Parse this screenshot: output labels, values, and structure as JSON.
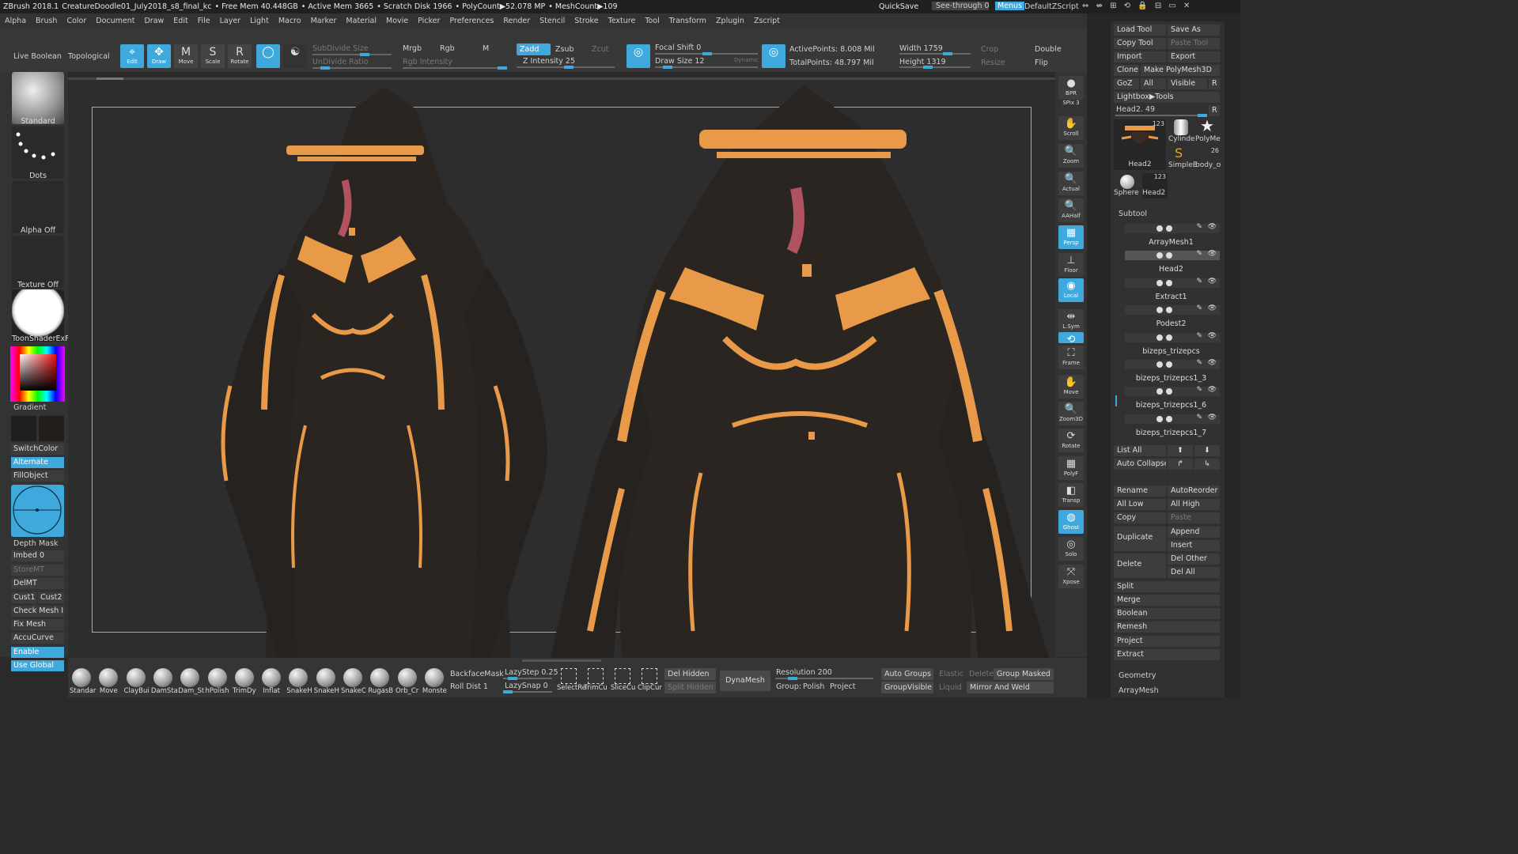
{
  "titlebar": {
    "app": "ZBrush 2018.1",
    "file": "CreatureDoodle01_July2018_s8_final_kc",
    "free_mem": "• Free Mem 40.448GB",
    "active_mem": "• Active Mem 3665",
    "scratch": "• Scratch Disk 1966",
    "polycount": "• PolyCount▶52.078 MP",
    "meshcount": "• MeshCount▶109",
    "quicksave": "QuickSave",
    "seethrough": "See-through  0",
    "menus": "Menus",
    "script": "DefaultZScript"
  },
  "menubar": [
    "Alpha",
    "Brush",
    "Color",
    "Document",
    "Draw",
    "Edit",
    "File",
    "Layer",
    "Light",
    "Macro",
    "Marker",
    "Material",
    "Movie",
    "Picker",
    "Preferences",
    "Render",
    "Stencil",
    "Stroke",
    "Texture",
    "Tool",
    "Transform",
    "Zplugin",
    "Zscript"
  ],
  "topshelf": {
    "live_boolean": "Live Boolean",
    "topological": "Topological",
    "tools": [
      "Edit",
      "Draw",
      "Move",
      "Scale",
      "Rotate"
    ],
    "subdivide_size": "SubDivide Size",
    "undivide_ratio": "UnDivide Ratio",
    "mrgb": "Mrgb",
    "rgb": "Rgb",
    "m": "M",
    "rgb_intensity": "Rgb Intensity",
    "zadd": "Zadd",
    "zsub": "Zsub",
    "zcut": "Zcut",
    "z_intensity": "Z Intensity 25",
    "focal_shift": "Focal Shift 0",
    "draw_size": "Draw Size 12",
    "dynamic": "Dynamic",
    "active_points": "ActivePoints: 8.008 Mil",
    "total_points": "TotalPoints: 48.797 Mil",
    "width": "Width 1759",
    "height": "Height 1319",
    "crop": "Crop",
    "resize": "Resize",
    "double": "Double",
    "flip": "Flip"
  },
  "leftshelf": {
    "brush": "Standard",
    "stroke": "Dots",
    "alpha": "Alpha Off",
    "texture": "Texture Off",
    "material": "ToonShaderExF",
    "gradient": "Gradient",
    "switchcolor": "SwitchColor",
    "alternate": "Alternate",
    "fillobject": "FillObject",
    "depth_mask": "Depth Mask",
    "imbed": "Imbed 0",
    "storemt": "StoreMT",
    "delmt": "DelMT",
    "cust1": "Cust1",
    "cust2": "Cust2",
    "check_mesh": "Check Mesh In",
    "fix_mesh": "Fix Mesh",
    "accucurve": "AccuCurve",
    "enable": "Enable",
    "use_global": "Use Global"
  },
  "rightshelf": [
    {
      "label": "BPR",
      "icon": "bpr-sphere-icon"
    },
    {
      "label": "SPix 3",
      "icon": ""
    },
    {
      "label": "Scroll",
      "icon": "hand-icon"
    },
    {
      "label": "Zoom",
      "icon": "zoom-icon"
    },
    {
      "label": "Actual",
      "icon": "zoom-icon"
    },
    {
      "label": "AAHalf",
      "icon": "zoom-icon"
    },
    {
      "label": "Persp",
      "icon": "grid-icon"
    },
    {
      "label": "Floor",
      "icon": "floor-icon"
    },
    {
      "label": "Local",
      "icon": "local-icon"
    },
    {
      "label": "L.Sym",
      "icon": "sym-icon"
    },
    {
      "label": "xyz",
      "icon": "xyz-icon"
    },
    {
      "label": "Frame",
      "icon": "frame-icon"
    },
    {
      "label": "Move",
      "icon": "hand-icon"
    },
    {
      "label": "Zoom3D",
      "icon": "zoom-icon"
    },
    {
      "label": "Rotate",
      "icon": "rotate-icon"
    },
    {
      "label": "PolyF",
      "icon": "polyframe-icon"
    },
    {
      "label": "Transp",
      "icon": "transp-icon"
    },
    {
      "label": "Ghost",
      "icon": "ghost-icon"
    },
    {
      "label": "Solo",
      "icon": "solo-icon"
    },
    {
      "label": "Xpose",
      "icon": "xpose-icon"
    }
  ],
  "tool_palette": {
    "load_tool": "Load Tool",
    "save_as": "Save As",
    "copy_tool": "Copy Tool",
    "paste_tool": "Paste Tool",
    "import": "Import",
    "export": "Export",
    "clone": "Clone",
    "make_polymesh": "Make PolyMesh3D",
    "goz": "GoZ",
    "all": "All",
    "visible": "Visible",
    "r": "R",
    "lightbox_tools": "Lightbox▶Tools",
    "current": "Head2. 49",
    "thumb_main": "Head2",
    "thumb_main_count": "123",
    "thumbs": [
      "Cylinde",
      "PolyMe",
      "SimpleE",
      "body_o",
      "Sphere",
      "Head2"
    ],
    "thumb_count_26": "26",
    "thumb_count_123": "123"
  },
  "subtool": {
    "title": "Subtool",
    "items": [
      "ArrayMesh1",
      "Head2",
      "Extract1",
      "Podest2",
      "bizeps_trizepcs",
      "bizeps_trizepcs1_3",
      "bizeps_trizepcs1_6",
      "bizeps_trizepcs1_7"
    ],
    "list_all": "List All",
    "auto_collapse": "Auto Collapse",
    "rename": "Rename",
    "autoreorder": "AutoReorder",
    "all_low": "All Low",
    "all_high": "All High",
    "copy": "Copy",
    "paste": "Paste",
    "duplicate": "Duplicate",
    "append": "Append",
    "insert": "Insert",
    "delete": "Delete",
    "del_other": "Del Other",
    "del_all": "Del All",
    "split": "Split",
    "merge": "Merge",
    "boolean": "Boolean",
    "remesh": "Remesh",
    "project": "Project",
    "extract": "Extract",
    "geometry": "Geometry",
    "arraymesh": "ArrayMesh"
  },
  "bottom": {
    "brushes": [
      "Standar",
      "Move",
      "ClayBui",
      "DamSta",
      "Dam_St",
      "hPolish",
      "TrimDy",
      "Inflat",
      "SnakeH",
      "SnakeH",
      "SnakeC",
      "RugasB",
      "Orb_Cr",
      "Monste"
    ],
    "backface_mask": "BackfaceMask",
    "roll_dist": "Roll Dist 1",
    "lazystep": "LazyStep 0.25",
    "lazysnap": "LazySnap 0",
    "selects": [
      "SelectRe",
      "TrimCu",
      "SliceCu",
      "ClipCur"
    ],
    "del_hidden": "Del Hidden",
    "split_hidden": "Split Hidden",
    "dynamesh": "DynaMesh",
    "resolution": "Resolution 200",
    "group": "Group:",
    "polish": "Polish",
    "project": "Project",
    "auto_groups": "Auto Groups",
    "elastic": "Elastic",
    "delete": "Delete",
    "group_masked": "Group Masked",
    "groupvisible": "GroupVisible",
    "liquid": "Liquid",
    "mirror_weld": "Mirror And Weld"
  },
  "colors": {
    "accent": "#3fa9dd",
    "orange": "#e89a48",
    "dark": "#2a2521"
  }
}
